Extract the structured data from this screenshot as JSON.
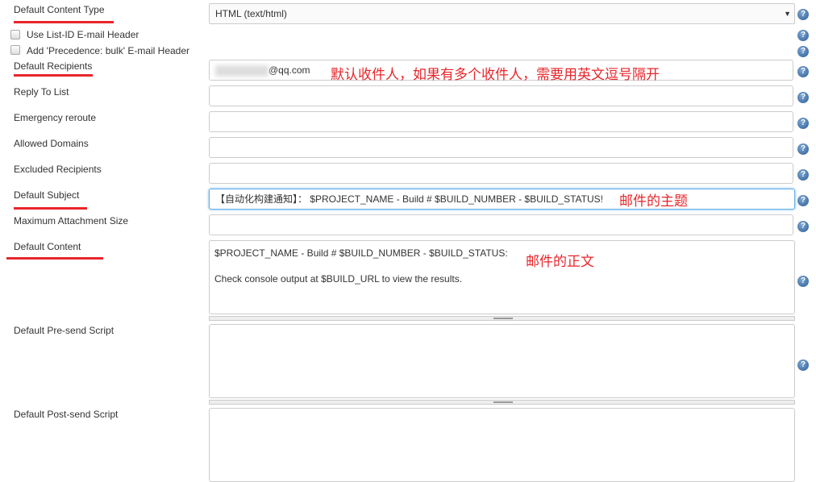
{
  "content_type": {
    "label": "Default Content Type",
    "value": "HTML (text/html)"
  },
  "checkboxes": [
    {
      "label": "Use List-ID E-mail Header",
      "checked": false
    },
    {
      "label": "Add 'Precedence: bulk' E-mail Header",
      "checked": false
    }
  ],
  "recipients": {
    "label": "Default Recipients",
    "value_suffix": "@qq.com",
    "note": "默认收件人，如果有多个收件人，需要用英文逗号隔开"
  },
  "reply_to": {
    "label": "Reply To List",
    "value": ""
  },
  "emergency": {
    "label": "Emergency reroute",
    "value": ""
  },
  "allowed": {
    "label": "Allowed Domains",
    "value": ""
  },
  "excluded": {
    "label": "Excluded Recipients",
    "value": ""
  },
  "subject": {
    "label": "Default Subject",
    "value": "【自动化构建通知】： $PROJECT_NAME - Build # $BUILD_NUMBER - $BUILD_STATUS!",
    "note": "邮件的主题"
  },
  "max_attach": {
    "label": "Maximum Attachment Size",
    "value": ""
  },
  "content": {
    "label": "Default Content",
    "value": "$PROJECT_NAME - Build # $BUILD_NUMBER - $BUILD_STATUS:\n\nCheck console output at $BUILD_URL to view the results.",
    "note": "邮件的正文"
  },
  "presend": {
    "label": "Default Pre-send Script",
    "value": ""
  },
  "postsend": {
    "label": "Default Post-send Script",
    "value": ""
  },
  "help_icon": "?",
  "colors": {
    "annotation": "#e8262b",
    "focus": "#66afe9"
  }
}
